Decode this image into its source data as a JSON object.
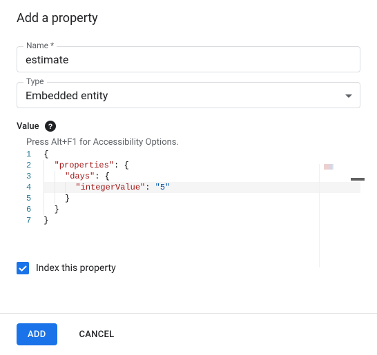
{
  "dialog": {
    "title": "Add a property"
  },
  "fields": {
    "name": {
      "label": "Name *",
      "value": "estimate"
    },
    "type": {
      "label": "Type",
      "selected": "Embedded entity"
    },
    "value": {
      "label": "Value",
      "accessibility_hint": "Press Alt+F1 for Accessibility Options."
    }
  },
  "code": {
    "lines": [
      "1",
      "2",
      "3",
      "4",
      "5",
      "6",
      "7"
    ],
    "tokens": {
      "l1_brace": "{",
      "l2_key": "\"properties\"",
      "l2_colon": ": ",
      "l2_brace": "{",
      "l3_key": "\"days\"",
      "l3_colon": ": ",
      "l3_brace": "{",
      "l4_key": "\"integerValue\"",
      "l4_colon": ": ",
      "l4_val": "\"5\"",
      "l5_brace": "}",
      "l6_brace": "}",
      "l7_brace": "}"
    }
  },
  "checkbox": {
    "label": "Index this property",
    "checked": true
  },
  "actions": {
    "add": "ADD",
    "cancel": "CANCEL"
  }
}
